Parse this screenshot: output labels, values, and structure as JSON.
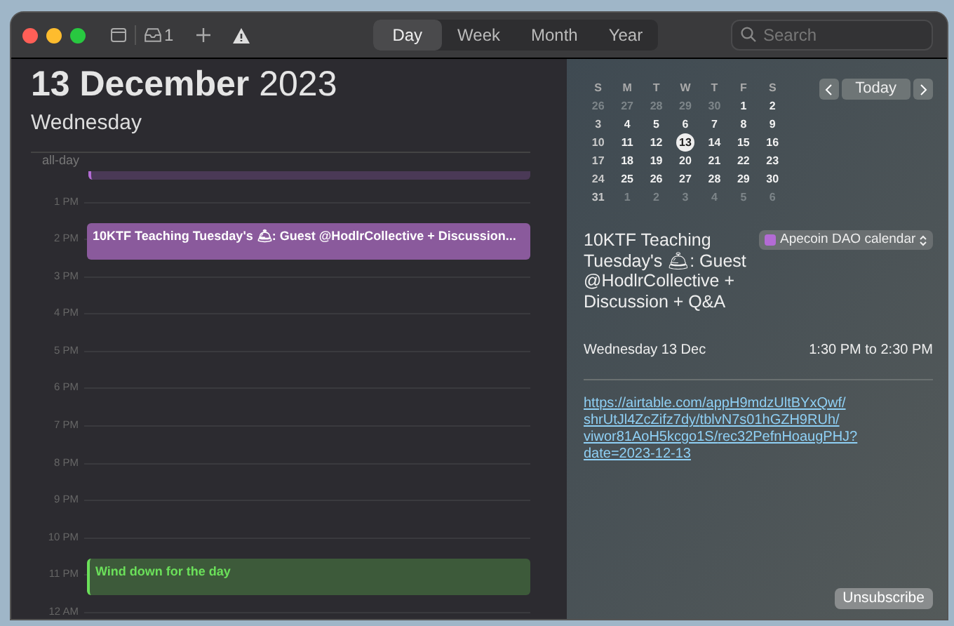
{
  "toolbar": {
    "inbox_count": "1",
    "views": [
      {
        "label": "Day",
        "selected": true
      },
      {
        "label": "Week",
        "selected": false
      },
      {
        "label": "Month",
        "selected": false
      },
      {
        "label": "Year",
        "selected": false
      }
    ],
    "search": {
      "placeholder": "Search"
    }
  },
  "day_header": {
    "title": "**13 December** 2023",
    "weekday": "Wednesday",
    "all_day_label": "all-day"
  },
  "timeline": {
    "hours": [
      {
        "label": "1 PM"
      },
      {
        "label": "2 PM",
        "events": [
          {
            "title": "10KTF Teaching Tuesday's 🛎: Guest @HodlrCollective + Discussion...",
            "color": "#8a5a9c",
            "selected": true
          }
        ]
      },
      {
        "label": "3 PM"
      },
      {
        "label": "4 PM"
      },
      {
        "label": "5 PM"
      },
      {
        "label": "6 PM"
      },
      {
        "label": "7 PM"
      },
      {
        "label": "8 PM"
      },
      {
        "label": "9 PM"
      },
      {
        "label": "10 PM"
      },
      {
        "label": "11 PM",
        "events": [
          {
            "title": "Wind down for the day",
            "color": "#3d5a3a",
            "selected": false
          }
        ]
      },
      {
        "label": "12 AM"
      }
    ]
  },
  "mini_calendar": {
    "weekdays": [
      "S",
      "M",
      "T",
      "W",
      "T",
      "F",
      "S"
    ],
    "weeks": [
      [
        {
          "d": "26",
          "muted": true,
          "selected": false
        },
        {
          "d": "27",
          "muted": true,
          "selected": false
        },
        {
          "d": "28",
          "muted": true,
          "selected": false
        },
        {
          "d": "29",
          "muted": true,
          "selected": false
        },
        {
          "d": "30",
          "muted": true,
          "selected": false
        },
        {
          "d": "1",
          "muted": false,
          "selected": false
        },
        {
          "d": "2",
          "muted": false,
          "selected": false
        }
      ],
      [
        {
          "d": "3",
          "muted": false,
          "selected": false
        },
        {
          "d": "4",
          "muted": false,
          "selected": false
        },
        {
          "d": "5",
          "muted": false,
          "selected": false
        },
        {
          "d": "6",
          "muted": false,
          "selected": false
        },
        {
          "d": "7",
          "muted": false,
          "selected": false
        },
        {
          "d": "8",
          "muted": false,
          "selected": false
        },
        {
          "d": "9",
          "muted": false,
          "selected": false
        }
      ],
      [
        {
          "d": "10",
          "muted": false,
          "selected": false
        },
        {
          "d": "11",
          "muted": false,
          "selected": false
        },
        {
          "d": "12",
          "muted": false,
          "selected": false
        },
        {
          "d": "13",
          "muted": false,
          "selected": true
        },
        {
          "d": "14",
          "muted": false,
          "selected": false
        },
        {
          "d": "15",
          "muted": false,
          "selected": false
        },
        {
          "d": "16",
          "muted": false,
          "selected": false
        }
      ],
      [
        {
          "d": "17",
          "muted": false,
          "selected": false
        },
        {
          "d": "18",
          "muted": false,
          "selected": false
        },
        {
          "d": "19",
          "muted": false,
          "selected": false
        },
        {
          "d": "20",
          "muted": false,
          "selected": false
        },
        {
          "d": "21",
          "muted": false,
          "selected": false
        },
        {
          "d": "22",
          "muted": false,
          "selected": false
        },
        {
          "d": "23",
          "muted": false,
          "selected": false
        }
      ],
      [
        {
          "d": "24",
          "muted": false,
          "selected": false
        },
        {
          "d": "25",
          "muted": false,
          "selected": false
        },
        {
          "d": "26",
          "muted": false,
          "selected": false
        },
        {
          "d": "27",
          "muted": false,
          "selected": false
        },
        {
          "d": "28",
          "muted": false,
          "selected": false
        },
        {
          "d": "29",
          "muted": false,
          "selected": false
        },
        {
          "d": "30",
          "muted": false,
          "selected": false
        }
      ],
      [
        {
          "d": "31",
          "muted": false,
          "selected": false
        },
        {
          "d": "1",
          "muted": true,
          "selected": false
        },
        {
          "d": "2",
          "muted": true,
          "selected": false
        },
        {
          "d": "3",
          "muted": true,
          "selected": false
        },
        {
          "d": "4",
          "muted": true,
          "selected": false
        },
        {
          "d": "5",
          "muted": true,
          "selected": false
        },
        {
          "d": "6",
          "muted": true,
          "selected": false
        }
      ]
    ],
    "today_button": "Today"
  },
  "event_detail": {
    "title": "10KTF Teaching Tuesday's 🛎: Guest @HodlrCollective + Discussion + Q&A",
    "calendar": {
      "name": "Apecoin DAO calendar",
      "color": "#b36bd4"
    },
    "date": "Wednesday 13 Dec",
    "time": "1:30 PM to 2:30 PM",
    "url": "https://airtable.com/appH9mdzUltBYxQwf/shrUtJl4ZcZifz7dy/tblvN7s01hGZH9RUh/viwor81AoH5kcgo1S/rec32PefnHoaugPHJ?date=2023-12-13"
  },
  "unsubscribe_button": "Unsubscribe"
}
